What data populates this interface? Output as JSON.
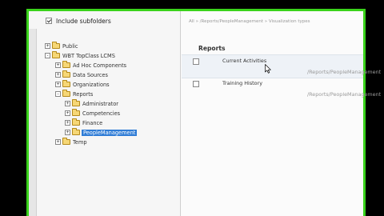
{
  "include_subfolders": {
    "label": "Include subfolders",
    "checked": true
  },
  "tree": [
    {
      "label": "Public",
      "expander": "+",
      "selected": false
    },
    {
      "label": "WBT TopClass LCMS",
      "expander": "-",
      "selected": false
    },
    {
      "label": "Ad Hoc Components",
      "expander": "+",
      "selected": false
    },
    {
      "label": "Data Sources",
      "expander": "+",
      "selected": false
    },
    {
      "label": "Organizations",
      "expander": "+",
      "selected": false
    },
    {
      "label": "Reports",
      "expander": "-",
      "selected": false
    },
    {
      "label": "Administrator",
      "expander": "+",
      "selected": false
    },
    {
      "label": "Competencies",
      "expander": "+",
      "selected": false
    },
    {
      "label": "Finance",
      "expander": "+",
      "selected": false
    },
    {
      "label": "PeopleManagement",
      "expander": "+",
      "selected": true
    },
    {
      "label": "Temp",
      "expander": "+",
      "selected": false
    }
  ],
  "breadcrumb": "All » /Reports/PeopleManagement » Visualization types",
  "section_title": "Reports",
  "reports": [
    {
      "title": "Current Activities",
      "path": "/Reports/PeopleManagement"
    },
    {
      "title": "Training History",
      "path": "/Reports/PeopleManagement"
    }
  ],
  "colors": {
    "frame": "#3ad21b",
    "selection": "#2f7cd6",
    "folder": "#f6d776"
  }
}
